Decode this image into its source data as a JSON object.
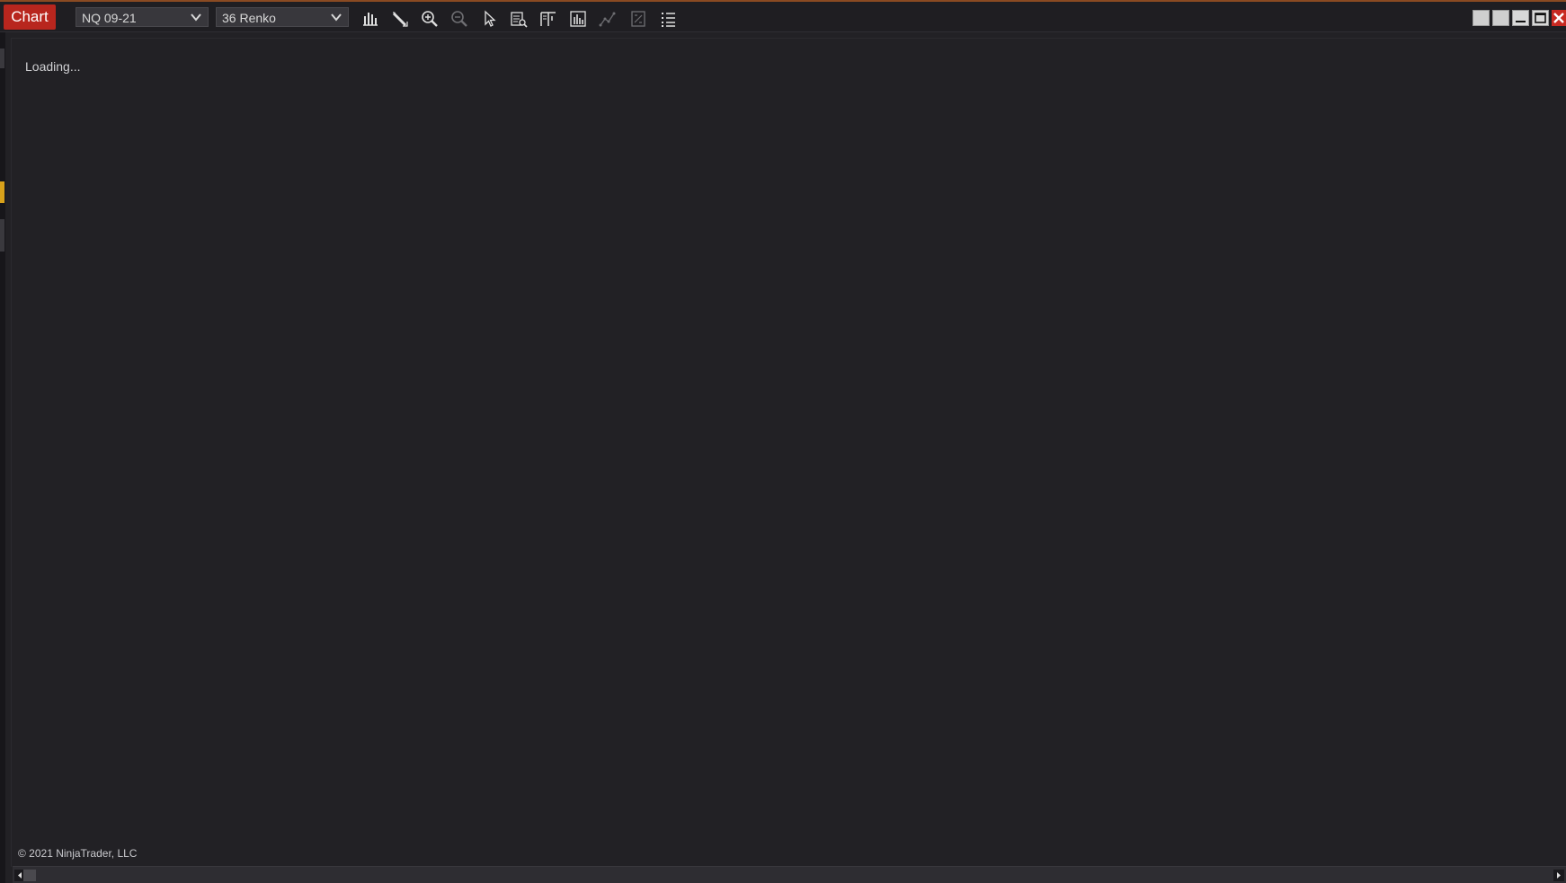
{
  "window": {
    "tab_label": "Chart",
    "accent_color": "#b8261e"
  },
  "toolbar": {
    "instrument": {
      "value": "NQ 09-21"
    },
    "bar_type": {
      "value": "36 Renko"
    },
    "icons": [
      "bars-icon",
      "drawing-tool-icon",
      "zoom-in-icon",
      "zoom-out-icon",
      "pointer-icon",
      "data-box-icon",
      "chart-trader-icon",
      "indicators-icon",
      "strategies-icon",
      "templates-icon",
      "properties-list-icon"
    ]
  },
  "window_controls": [
    "tile-left-icon",
    "tile-right-icon",
    "minimize-icon",
    "maximize-icon",
    "close-icon"
  ],
  "chart": {
    "status_text": "Loading...",
    "copyright": "© 2021 NinjaTrader, LLC"
  }
}
